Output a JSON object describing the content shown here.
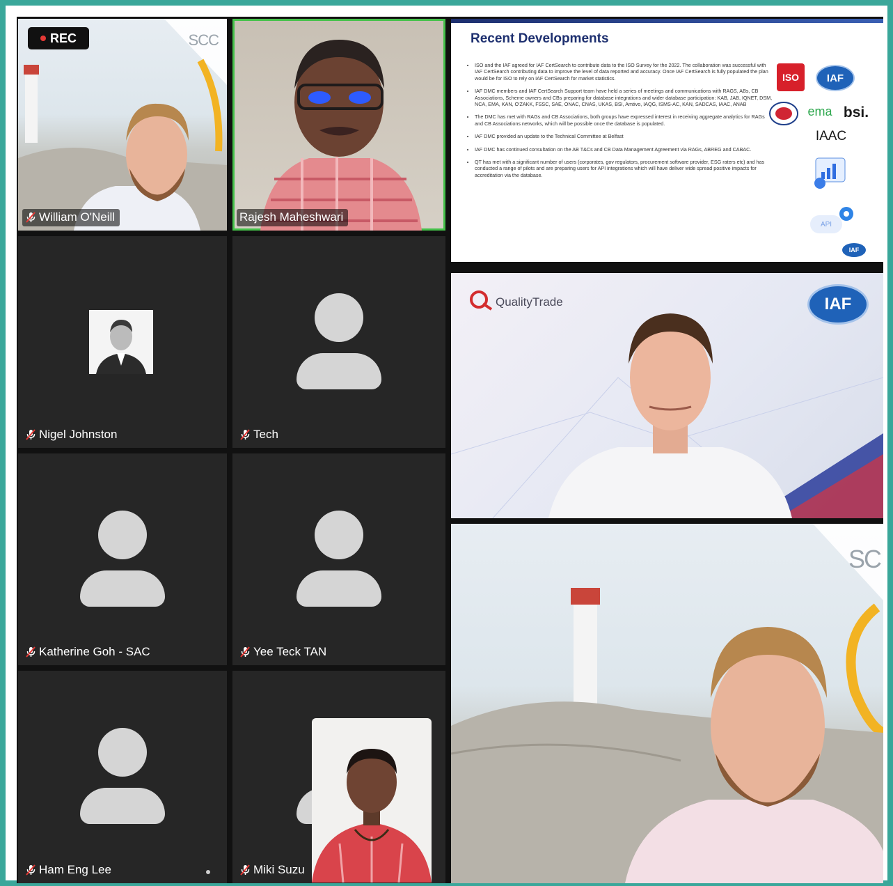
{
  "recording": {
    "label": "REC"
  },
  "participants": [
    {
      "name": "William O'Neill"
    },
    {
      "name": "Rajesh Maheshwari"
    },
    {
      "name": "Nigel Johnston"
    },
    {
      "name": "Tech"
    },
    {
      "name": "Katherine Goh - SAC"
    },
    {
      "name": "Yee Teck TAN"
    },
    {
      "name": "Ham Eng Lee"
    },
    {
      "name": "Miki Suzu"
    }
  ],
  "backdrop_text": {
    "scc_small": "SCC",
    "scc_large": "SC"
  },
  "slide": {
    "title": "Recent Developments",
    "bullets": [
      "ISO and the IAF agreed for IAF CertSearch to contribute data to the ISO Survey for the 2022. The collaboration was successful with IAF CertSearch contributing data to improve the level of data reported and accuracy. Once IAF CertSearch is fully populated the plan would be for ISO to rely on IAF CertSearch for market statistics.",
      "IAF DMC members and IAF CertSearch Support team have held a series of meetings and communications with RAGS, ABs, CB Associations, Scheme owners and CBs preparing for database integrations and wider database participation: KAB, JAB, IQNET, DSM, NCA, EMA, KAN, O'ZAKK, FSSC, SAE, ONAC, CNAS, UKAS, BSI, Amtivo, IAQG, ISMS-AC, KAN, SADCAS, IAAC, ANAB",
      "The DMC has met with RAGs and CB Associations, both groups have expressed interest in receiving aggregate analytics for RAGs and CB Associations networks, which will be possible once the database is populated.",
      "IAF DMC provided an update to the Technical Committee at Belfast",
      "IAF DMC has continued consultation on the AB T&Cs and CB Data Management Agreement via RAGs, ABREG and CABAC.",
      "QT has met with a significant number of users (corporates, gov regulators, procurement software provider, ESG raters etc) and has conducted a range of pilots and are preparing users for API integrations which will have deliver wide spread positive impacts for accreditation via the database."
    ],
    "logos": {
      "iso": "ISO",
      "iaf": "IAF",
      "ema": "ema",
      "bsi": "bsi.",
      "iaac": "IAAC",
      "api": "API"
    }
  },
  "qualitytrade": {
    "brand": "QualityTrade",
    "iaf": "IAF"
  },
  "colors": {
    "accent_teal": "#3aa79a",
    "active_speaker": "#45c14a",
    "rec_dot": "#e53935",
    "slide_navy": "#1d2f6f"
  }
}
